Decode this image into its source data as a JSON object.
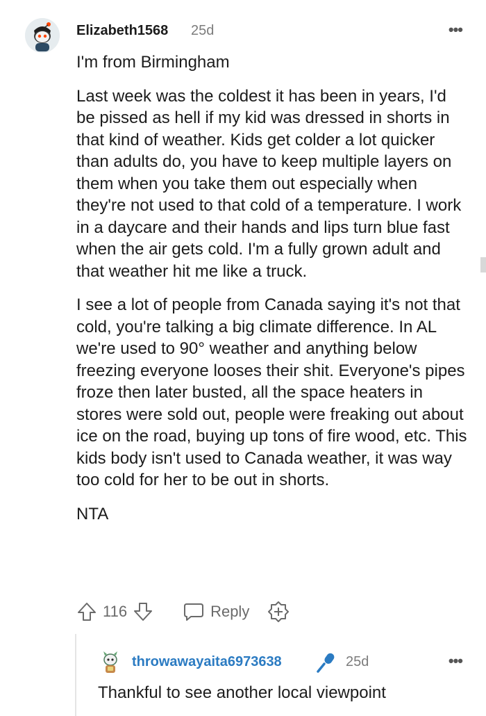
{
  "comment": {
    "username": "Elizabeth1568",
    "age": "25d",
    "more_label": "•••",
    "paragraphs": [
      "I'm from Birmingham",
      "Last week was the coldest it has been in years, I'd be pissed as hell if my kid was dressed in shorts in that kind of weather. Kids get colder a lot quicker than adults do, you have to keep multiple layers on them when you take them out especially when they're not used to that cold of a temperature. I work in a daycare and their hands and lips turn blue fast when the air gets cold. I'm a fully grown adult and that weather hit me like a truck.",
      "I see a lot of people from Canada saying it's not that cold, you're talking a big climate difference. In AL we're used to 90° weather and anything below freezing everyone looses their shit. Everyone's pipes froze then later busted, all the space heaters in stores were sold out, people were freaking out about ice on the road, buying up tons of fire wood, etc. This kids body isn't used to Canada weather, it was way too cold for her to be out in shorts.",
      "NTA"
    ],
    "actions": {
      "score": "116",
      "reply_label": "Reply"
    }
  },
  "reply": {
    "username": "throwawayaita6973638",
    "age": "25d",
    "more_label": "•••",
    "text": "Thankful to see another local viewpoint"
  },
  "icons": {
    "upvote": "upvote-icon",
    "downvote": "downvote-icon",
    "reply": "reply-bubble-icon",
    "award": "award-icon",
    "mic": "microphone-icon"
  },
  "colors": {
    "username_reply": "#2b7bc2",
    "meta": "#7c7c7c",
    "mic": "#2b7bc2"
  }
}
